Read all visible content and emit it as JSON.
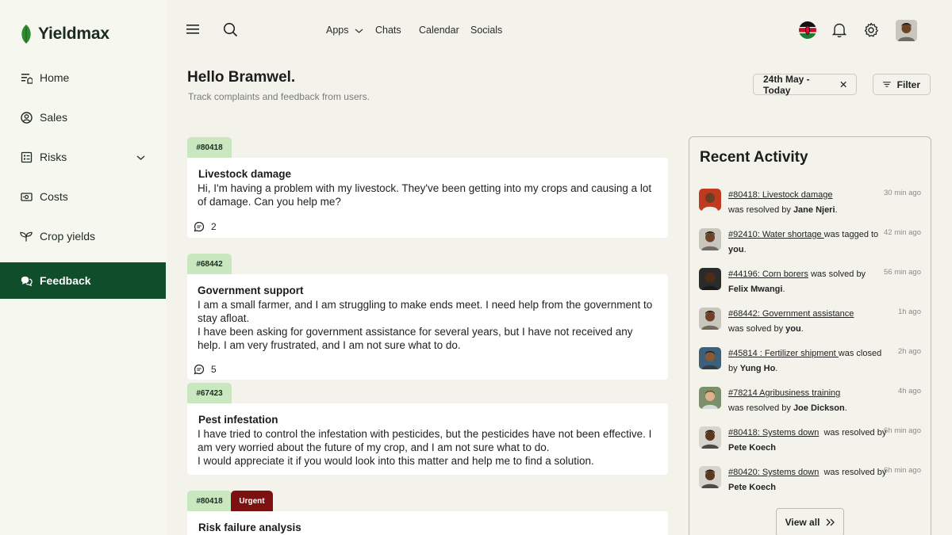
{
  "brand": {
    "name": "Yieldmax"
  },
  "sidebar": {
    "items": [
      {
        "label": "Home",
        "icon": "home-list-icon"
      },
      {
        "label": "Sales",
        "icon": "user-circle-icon"
      },
      {
        "label": "Risks",
        "icon": "checklist-icon",
        "expandable": true
      },
      {
        "label": "Costs",
        "icon": "banknote-icon"
      },
      {
        "label": "Crop yields",
        "icon": "sprout-icon"
      },
      {
        "label": "Feedback",
        "icon": "chat-bubbles-icon",
        "active": true
      }
    ]
  },
  "topbar": {
    "nav": [
      {
        "label": "Apps",
        "has_dropdown": true
      },
      {
        "label": "Chats"
      },
      {
        "label": "Calendar"
      },
      {
        "label": "Socials"
      }
    ]
  },
  "header": {
    "greeting": "Hello Bramwel.",
    "subtitle": "Track complaints and feedback from users.",
    "date_filter": "24th May - Today",
    "filter_label": "Filter"
  },
  "feed": [
    {
      "id": "#80418",
      "title": "Livestock damage",
      "body": "Hi, I'm having a problem with my livestock. They've been getting into my crops and causing a lot of damage. Can you help me?",
      "comments": "2"
    },
    {
      "id": "#68442",
      "title": "Government support",
      "body_lines": [
        "I am a small farmer, and I am struggling to make ends meet. I need help from the government to stay afloat.",
        "I have been asking for government assistance for several years, but I have not received any help. I am very frustrated, and I am not sure what to do."
      ],
      "comments": "5"
    },
    {
      "id": "#67423",
      "title": "Pest infestation",
      "body_lines": [
        "I have tried to control the infestation with pesticides, but the pesticides have not been effective. I am very worried about the future of my crop, and I am not sure what to do.",
        "I would appreciate it if you would look into this matter and help me to find a solution."
      ]
    },
    {
      "id": "#80418",
      "badge": "Urgent",
      "title": "Risk failure analysis"
    }
  ],
  "activity": {
    "title": "Recent Activity",
    "view_all": "View all",
    "items": [
      {
        "link": "#80418: Livestock damage",
        "mid": "was resolved by",
        "who": "Jane Njeri",
        "time": "30 min ago"
      },
      {
        "link": "#92410: Water shortage ",
        "mid": "was tagged to",
        "who": "you",
        "time": "42 min ago"
      },
      {
        "link": "#44196: Corn borers",
        "mid": "was solved by",
        "who": "Felix Mwangi",
        "time": "56 min ago"
      },
      {
        "link": "#68442: Government assistance",
        "mid": "was solved by",
        "who": "you",
        "time": "1h ago"
      },
      {
        "link": "#45814 : Fertilizer shipment ",
        "mid": "was closed by",
        "who": "Yung Ho",
        "time": "2h ago"
      },
      {
        "link": "#78214 Agribusiness training",
        "mid": "was resolved by",
        "who": "Joe Dickson",
        "time": "4h ago"
      },
      {
        "link": "#80418: Systems down",
        "mid": "was resolved by",
        "who": "Pete Koech",
        "time": "6h min ago"
      },
      {
        "link": "#80420: Systems down",
        "mid": "was resolved by",
        "who": "Pete Koech",
        "time": "6h min ago"
      }
    ]
  },
  "colors": {
    "brand_green": "#0f4d2b",
    "tag_green": "#c9e8bf",
    "urgent_red": "#7d1010",
    "background": "#f3f3ec"
  }
}
